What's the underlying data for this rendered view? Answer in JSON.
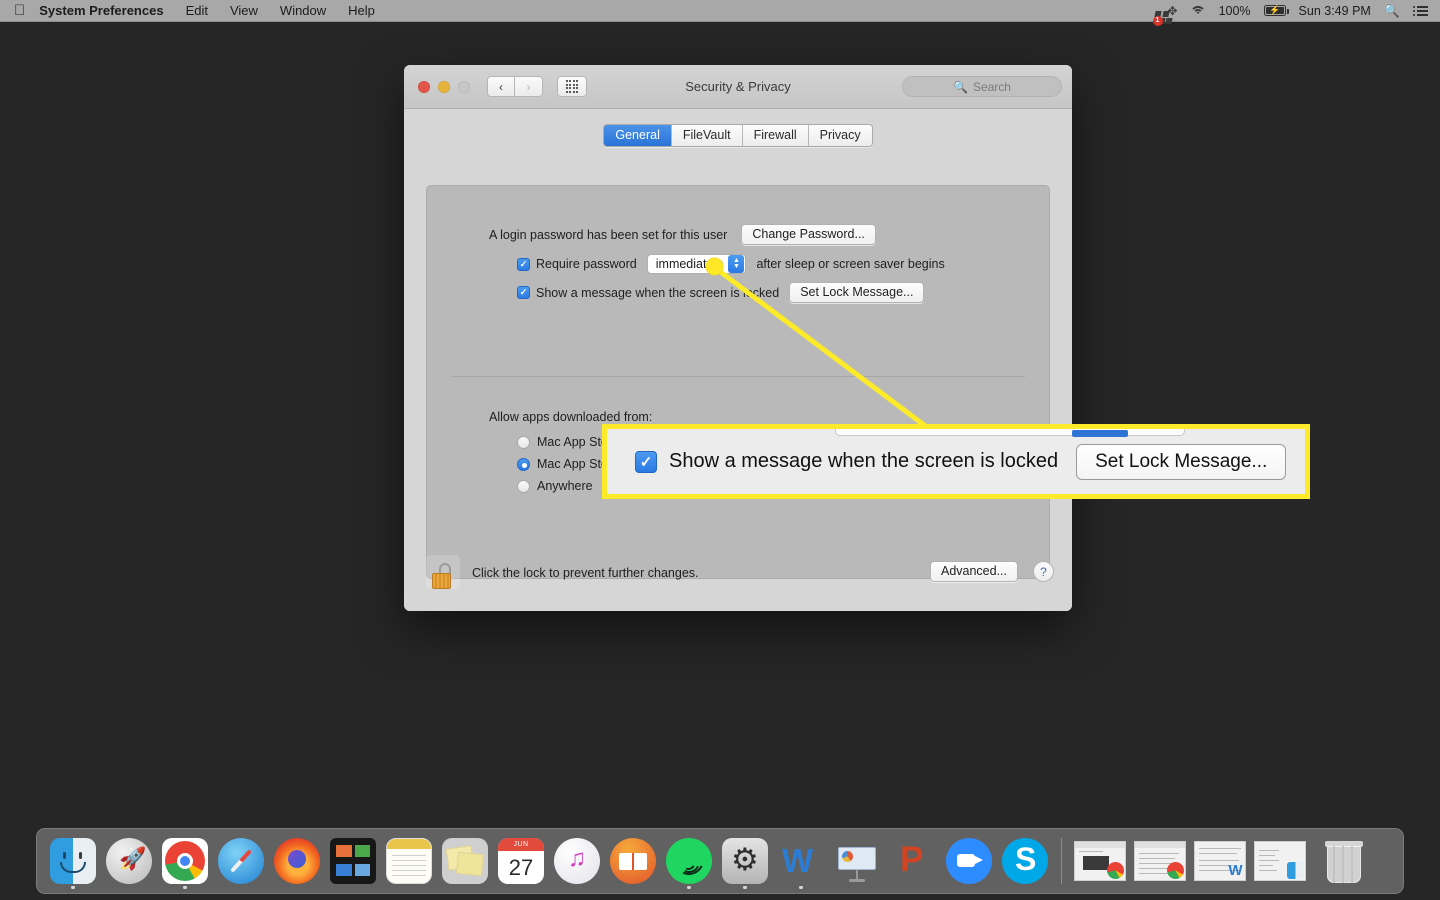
{
  "menubar": {
    "apple_icon": "apple-logo-icon",
    "items": [
      {
        "label": "System Preferences",
        "bold": true
      },
      {
        "label": "Edit",
        "bold": false
      },
      {
        "label": "View",
        "bold": false
      },
      {
        "label": "Window",
        "bold": false
      },
      {
        "label": "Help",
        "bold": false
      }
    ],
    "status": {
      "sync_badge": "1",
      "battery_percent": "100%",
      "clock": "Sun 3:49 PM",
      "icons": [
        "sync-badge-icon",
        "bluetooth-icon",
        "wifi-icon",
        "battery-charging-icon",
        "spotlight-search-icon",
        "notification-center-icon"
      ]
    }
  },
  "window": {
    "title": "Security & Privacy",
    "search_placeholder": "Search",
    "nav_back": "‹",
    "nav_forward": "›",
    "tabs": [
      {
        "label": "General",
        "active": true
      },
      {
        "label": "FileVault",
        "active": false
      },
      {
        "label": "Firewall",
        "active": false
      },
      {
        "label": "Privacy",
        "active": false
      }
    ],
    "general": {
      "password_set_text": "A login password has been set for this user",
      "change_password_button": "Change Password...",
      "require_password_label": "Require password",
      "require_password_value": "immediately",
      "require_password_suffix": "after sleep or screen saver begins",
      "show_message_label": "Show a message when the screen is locked",
      "set_lock_message_button": "Set Lock Message...",
      "allow_apps_label": "Allow apps downloaded from:",
      "radios": [
        {
          "label": "Mac App Store",
          "selected": false
        },
        {
          "label": "Mac App Store and identified developers",
          "selected": true
        },
        {
          "label": "Anywhere",
          "selected": false
        }
      ]
    },
    "footer": {
      "lock_icon": "open-padlock-icon",
      "lock_text": "Click the lock to prevent further changes.",
      "advanced_button": "Advanced...",
      "help_button": "?"
    }
  },
  "callout": {
    "checkbox_checked": true,
    "label": "Show a message when the screen is locked",
    "button": "Set Lock Message...",
    "border_color": "#fdeb2a",
    "background_color": "#ececec",
    "leader_color": "#fdeb2a"
  },
  "dock": {
    "apps": [
      {
        "name": "finder",
        "running": true
      },
      {
        "name": "launchpad",
        "running": false
      },
      {
        "name": "chrome",
        "running": true
      },
      {
        "name": "safari",
        "running": false
      },
      {
        "name": "firefox",
        "running": false
      },
      {
        "name": "screens",
        "running": false
      },
      {
        "name": "notes",
        "running": false
      },
      {
        "name": "stickies",
        "running": false
      },
      {
        "name": "calendar",
        "running": false,
        "month": "JUN",
        "day": "27"
      },
      {
        "name": "itunes",
        "running": false
      },
      {
        "name": "ibooks",
        "running": false
      },
      {
        "name": "spotify",
        "running": true
      },
      {
        "name": "system-preferences",
        "running": true
      },
      {
        "name": "word",
        "running": true
      },
      {
        "name": "keynote",
        "running": false
      },
      {
        "name": "powerpoint",
        "running": false
      },
      {
        "name": "zoom",
        "running": false
      },
      {
        "name": "skype",
        "running": false
      }
    ],
    "minimized": [
      "chrome-window",
      "chrome-window",
      "word-document",
      "finder-document"
    ],
    "trash": "trash-icon"
  },
  "colors": {
    "accent_blue": "#2a7ae4",
    "highlight_yellow": "#fdeb2a",
    "desktop": "#262626",
    "window_bg": "#d6d6d6"
  }
}
